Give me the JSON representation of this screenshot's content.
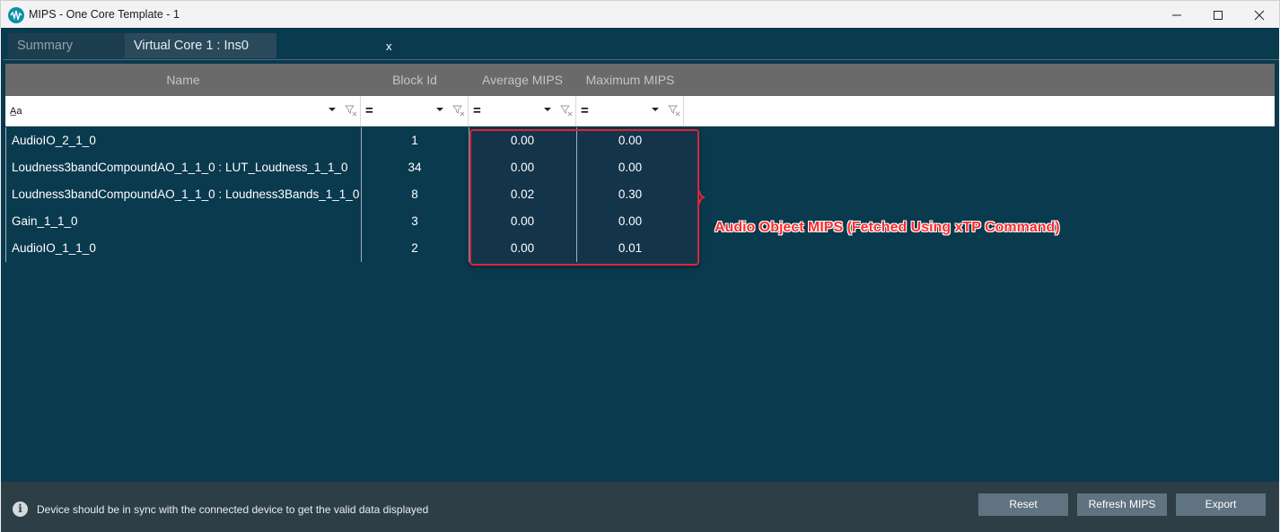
{
  "window": {
    "title": "MIPS - One Core Template - 1",
    "icon": "waveform-icon"
  },
  "tabs": [
    {
      "label": "Summary",
      "active": false
    },
    {
      "label": "Virtual Core 1 : Ins0",
      "active": true,
      "close_label": "x"
    }
  ],
  "grid": {
    "columns": [
      "Name",
      "Block Id",
      "Average MIPS",
      "Maximum MIPS"
    ],
    "filters": {
      "name_operator": "A̲a",
      "numeric_operator": "="
    },
    "rows": [
      {
        "name": "AudioIO_2_1_0",
        "block_id": "1",
        "avg": "0.00",
        "max": "0.00"
      },
      {
        "name": "Loudness3bandCompoundAO_1_1_0 : LUT_Loudness_1_1_0",
        "block_id": "34",
        "avg": "0.00",
        "max": "0.00"
      },
      {
        "name": "Loudness3bandCompoundAO_1_1_0 : Loudness3Bands_1_1_0",
        "block_id": "8",
        "avg": "0.02",
        "max": "0.30"
      },
      {
        "name": "Gain_1_1_0",
        "block_id": "3",
        "avg": "0.00",
        "max": "0.00"
      },
      {
        "name": "AudioIO_1_1_0",
        "block_id": "2",
        "avg": "0.00",
        "max": "0.01"
      }
    ]
  },
  "annotation": {
    "text": "Audio Object MIPS (Fetched Using xTP Command)",
    "color": "#ff2a2a"
  },
  "footer": {
    "info_text": "Device should be in sync with the connected device to get the valid data displayed",
    "buttons": {
      "reset": "Reset",
      "refresh": "Refresh MIPS",
      "export": "Export"
    }
  },
  "colors": {
    "background": "#0a3a4e",
    "header": "#6a6a6a",
    "footer": "#2e3e47",
    "button": "#5f7381"
  }
}
